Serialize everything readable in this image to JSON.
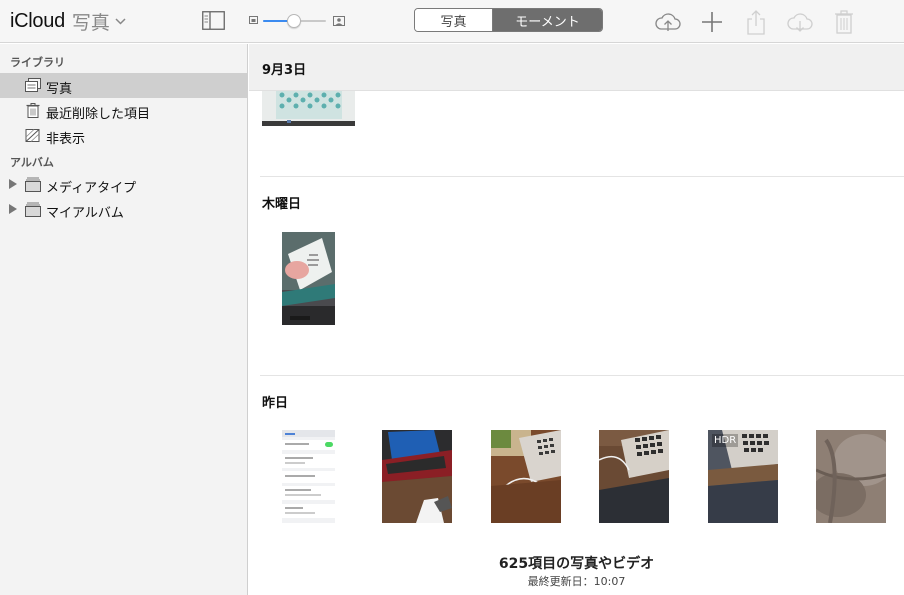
{
  "toolbar": {
    "brand": "iCloud",
    "app_name": "写真",
    "segmented": {
      "photos": "写真",
      "moments": "モーメント",
      "selected": "moments"
    },
    "zoom_level": 0.4,
    "icons": [
      "upload-icon",
      "add-icon",
      "share-icon",
      "download-icon",
      "trash-icon"
    ]
  },
  "sidebar": {
    "library_heading": "ライブラリ",
    "library_items": [
      {
        "label": "写真",
        "icon": "photos-icon",
        "selected": true
      },
      {
        "label": "最近削除した項目",
        "icon": "trash-icon"
      },
      {
        "label": "非表示",
        "icon": "hidden-icon"
      }
    ],
    "albums_heading": "アルバム",
    "album_items": [
      {
        "label": "メディアタイプ",
        "icon": "album-stack-icon"
      },
      {
        "label": "マイアルバム",
        "icon": "album-stack-icon"
      }
    ]
  },
  "main": {
    "moments": [
      {
        "title": "9月3日"
      },
      {
        "title": "木曜日"
      },
      {
        "title": "昨日",
        "hdr_badge": "HDR"
      }
    ],
    "footer": {
      "count": "625項目の写真やビデオ",
      "updated": "最終更新日：10:07"
    }
  },
  "colors": {
    "accent": "#3b8bf0",
    "sidebar_bg": "#f3f3f3",
    "selected_bg": "#cfcfcf"
  }
}
